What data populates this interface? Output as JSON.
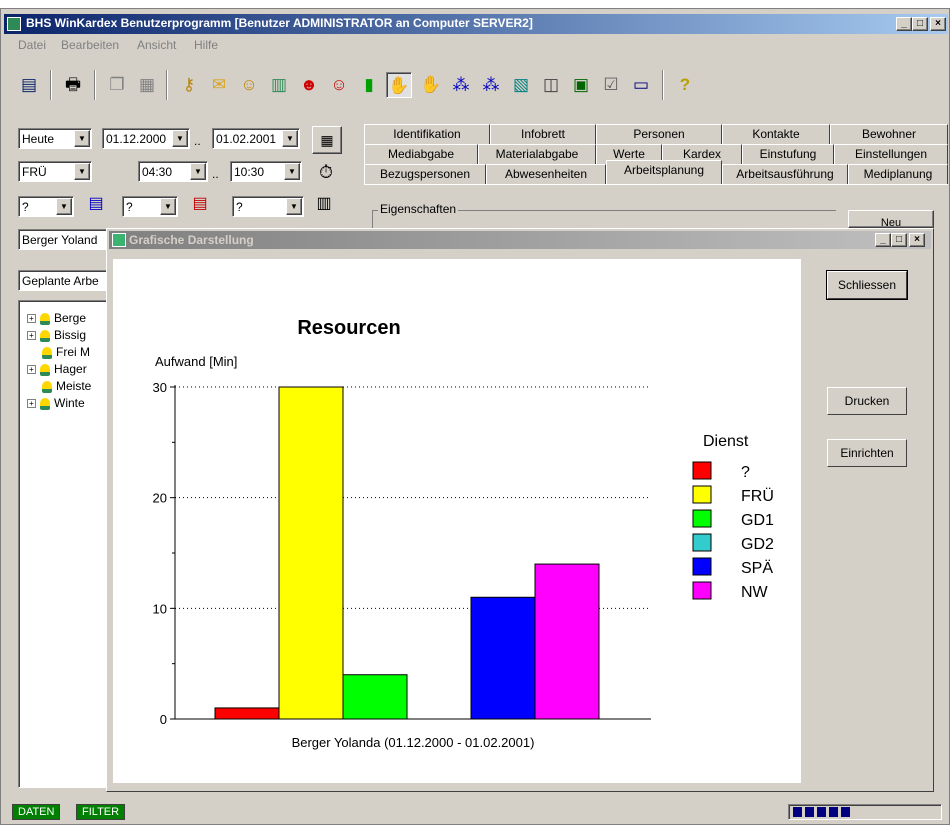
{
  "window": {
    "title": "BHS WinKardex Benutzerprogramm [Benutzer ADMINISTRATOR an Computer SERVER2]",
    "buttons": [
      "_",
      "□",
      "×"
    ]
  },
  "menu": [
    "Datei",
    "Bearbeiten",
    "Ansicht",
    "Hilfe"
  ],
  "toolbar_icons": [
    "document-icon",
    "printer-icon",
    "copy-icon",
    "paste-icon",
    "key-icon",
    "envelope-icon",
    "people-icon",
    "calculator-icon",
    "person-red-icon",
    "couple-icon",
    "door-icon",
    "hand-icon",
    "hand-red-icon",
    "network-icon",
    "network2-icon",
    "grid-icon",
    "chart-icon",
    "notebook-icon",
    "checklist-icon",
    "window-icon",
    "help-icon"
  ],
  "filters": {
    "period": "Heute",
    "date_from": "01.12.2000",
    "date_to": "01.02.2001",
    "dienst": "FRÜ",
    "time_from": "04:30",
    "time_to": "10:30",
    "filter1": "?",
    "filter2": "?",
    "filter3": "?",
    "range_sep": ".."
  },
  "tabs": {
    "row1": [
      "Identifikation",
      "Infobrett",
      "Personen",
      "Kontakte",
      "Bewohner"
    ],
    "row2": [
      "Mediabgabe",
      "Materialabgabe",
      "Werte",
      "Kardex",
      "Einstufung",
      "Einstellungen"
    ],
    "row3": [
      "Bezugspersonen",
      "Abwesenheiten",
      "Arbeitsplanung",
      "Arbeitsausführung",
      "Mediplanung"
    ],
    "active": "Arbeitsplanung"
  },
  "group_label": "Eigenschaften",
  "neu_button": "Neu",
  "left_panel": {
    "person_field": "Berger Yoland",
    "list_field": "Geplante Arbe",
    "tree": [
      {
        "label": "Berge",
        "expander": true
      },
      {
        "label": "Bissig",
        "expander": true
      },
      {
        "label": "Frei M",
        "expander": false
      },
      {
        "label": "Hager",
        "expander": true
      },
      {
        "label": "Meiste",
        "expander": false
      },
      {
        "label": "Winte",
        "expander": true
      }
    ]
  },
  "dialog": {
    "title": "Grafische Darstellung",
    "buttons": {
      "close": "Schliessen",
      "print": "Drucken",
      "setup": "Einrichten"
    }
  },
  "chart_data": {
    "type": "bar",
    "title": "Resourcen",
    "ylabel": "Aufwand [Min]",
    "xlabel": "Berger Yolanda (01.12.2000 - 01.02.2001)",
    "ylim": [
      0,
      30
    ],
    "yticks": [
      0,
      10,
      20,
      30
    ],
    "grid": true,
    "legend_title": "Dienst",
    "legend_position": "right",
    "series": [
      {
        "name": "?",
        "value": 1,
        "color": "#ff0000"
      },
      {
        "name": "FRÜ",
        "value": 30,
        "color": "#ffff00"
      },
      {
        "name": "GD1",
        "value": 4,
        "color": "#00ff00"
      },
      {
        "name": "GD2",
        "value": 0,
        "color": "#33cccc"
      },
      {
        "name": "SPÄ",
        "value": 11,
        "color": "#0000ff"
      },
      {
        "name": "NW",
        "value": 14,
        "color": "#ff00ff"
      }
    ]
  },
  "status": {
    "items": [
      "DATEN",
      "FILTER"
    ]
  }
}
